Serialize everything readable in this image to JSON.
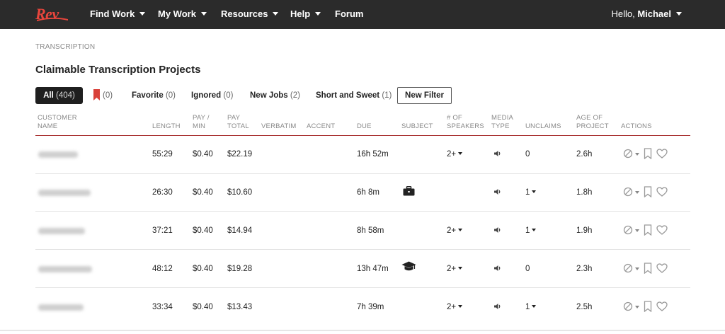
{
  "nav": {
    "logo_text": "Rev",
    "items": [
      "Find Work",
      "My Work",
      "Resources",
      "Help"
    ],
    "forum": "Forum",
    "greeting": "Hello, ",
    "user": "Michael"
  },
  "breadcrumb": "TRANSCRIPTION",
  "page_title": "Claimable Transcription Projects",
  "tabs": {
    "all_label": "All",
    "all_count": "(404)",
    "bookmarked_count": "(0)",
    "favorite_label": "Favorite",
    "favorite_count": "(0)",
    "ignored_label": "Ignored",
    "ignored_count": "(0)",
    "newjobs_label": "New Jobs",
    "newjobs_count": "(2)",
    "short_label": "Short and Sweet",
    "short_count": "(1)",
    "new_filter": "New Filter"
  },
  "columns": {
    "customer_1": "CUSTOMER",
    "customer_2": "NAME",
    "length": "LENGTH",
    "paymin_1": "PAY /",
    "paymin_2": "MIN",
    "paytotal_1": "PAY",
    "paytotal_2": "TOTAL",
    "verbatim": "VERBATIM",
    "accent": "ACCENT",
    "due": "DUE",
    "subject": "SUBJECT",
    "speakers_1": "# OF",
    "speakers_2": "SPEAKERS",
    "media_1": "MEDIA",
    "media_2": "TYPE",
    "unclaims": "UNCLAIMS",
    "age_1": "AGE OF",
    "age_2": "PROJECT",
    "actions": "ACTIONS"
  },
  "rows": [
    {
      "length": "55:29",
      "pay_min": "$0.40",
      "pay_total": "$22.19",
      "due": "16h 52m",
      "subject": "",
      "speakers": "2+",
      "unclaims": "0",
      "age": "2.6h"
    },
    {
      "length": "26:30",
      "pay_min": "$0.40",
      "pay_total": "$10.60",
      "due": "6h 8m",
      "subject": "briefcase-icon",
      "speakers": "",
      "unclaims": "1",
      "age": "1.8h"
    },
    {
      "length": "37:21",
      "pay_min": "$0.40",
      "pay_total": "$14.94",
      "due": "8h 58m",
      "subject": "",
      "speakers": "2+",
      "unclaims": "1",
      "age": "1.9h"
    },
    {
      "length": "48:12",
      "pay_min": "$0.40",
      "pay_total": "$19.28",
      "due": "13h 47m",
      "subject": "graduation-cap-icon",
      "speakers": "2+",
      "unclaims": "0",
      "age": "2.3h"
    },
    {
      "length": "33:34",
      "pay_min": "$0.40",
      "pay_total": "$13.43",
      "due": "7h 39m",
      "subject": "",
      "speakers": "2+",
      "unclaims": "1",
      "age": "2.5h"
    }
  ],
  "colors": {
    "accent": "#e8453c",
    "nav_bg": "#2b2b2b",
    "header_rule": "#aa3333"
  }
}
